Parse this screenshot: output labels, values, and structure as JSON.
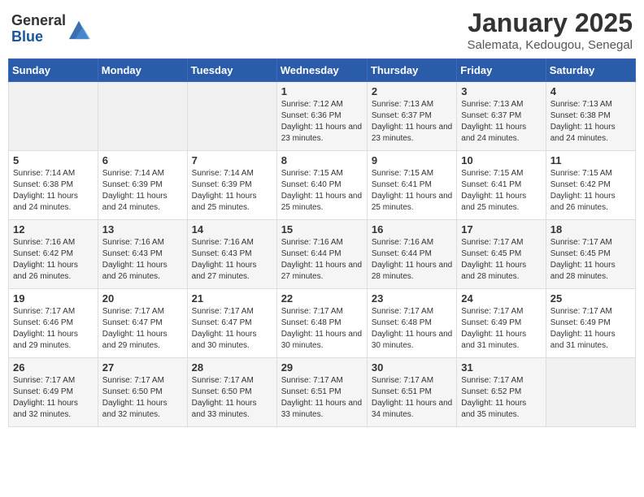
{
  "header": {
    "logo_general": "General",
    "logo_blue": "Blue",
    "month_title": "January 2025",
    "location": "Salemata, Kedougou, Senegal"
  },
  "weekdays": [
    "Sunday",
    "Monday",
    "Tuesday",
    "Wednesday",
    "Thursday",
    "Friday",
    "Saturday"
  ],
  "weeks": [
    [
      {
        "day": "",
        "sunrise": "",
        "sunset": "",
        "daylight": ""
      },
      {
        "day": "",
        "sunrise": "",
        "sunset": "",
        "daylight": ""
      },
      {
        "day": "",
        "sunrise": "",
        "sunset": "",
        "daylight": ""
      },
      {
        "day": "1",
        "sunrise": "Sunrise: 7:12 AM",
        "sunset": "Sunset: 6:36 PM",
        "daylight": "Daylight: 11 hours and 23 minutes."
      },
      {
        "day": "2",
        "sunrise": "Sunrise: 7:13 AM",
        "sunset": "Sunset: 6:37 PM",
        "daylight": "Daylight: 11 hours and 23 minutes."
      },
      {
        "day": "3",
        "sunrise": "Sunrise: 7:13 AM",
        "sunset": "Sunset: 6:37 PM",
        "daylight": "Daylight: 11 hours and 24 minutes."
      },
      {
        "day": "4",
        "sunrise": "Sunrise: 7:13 AM",
        "sunset": "Sunset: 6:38 PM",
        "daylight": "Daylight: 11 hours and 24 minutes."
      }
    ],
    [
      {
        "day": "5",
        "sunrise": "Sunrise: 7:14 AM",
        "sunset": "Sunset: 6:38 PM",
        "daylight": "Daylight: 11 hours and 24 minutes."
      },
      {
        "day": "6",
        "sunrise": "Sunrise: 7:14 AM",
        "sunset": "Sunset: 6:39 PM",
        "daylight": "Daylight: 11 hours and 24 minutes."
      },
      {
        "day": "7",
        "sunrise": "Sunrise: 7:14 AM",
        "sunset": "Sunset: 6:39 PM",
        "daylight": "Daylight: 11 hours and 25 minutes."
      },
      {
        "day": "8",
        "sunrise": "Sunrise: 7:15 AM",
        "sunset": "Sunset: 6:40 PM",
        "daylight": "Daylight: 11 hours and 25 minutes."
      },
      {
        "day": "9",
        "sunrise": "Sunrise: 7:15 AM",
        "sunset": "Sunset: 6:41 PM",
        "daylight": "Daylight: 11 hours and 25 minutes."
      },
      {
        "day": "10",
        "sunrise": "Sunrise: 7:15 AM",
        "sunset": "Sunset: 6:41 PM",
        "daylight": "Daylight: 11 hours and 25 minutes."
      },
      {
        "day": "11",
        "sunrise": "Sunrise: 7:15 AM",
        "sunset": "Sunset: 6:42 PM",
        "daylight": "Daylight: 11 hours and 26 minutes."
      }
    ],
    [
      {
        "day": "12",
        "sunrise": "Sunrise: 7:16 AM",
        "sunset": "Sunset: 6:42 PM",
        "daylight": "Daylight: 11 hours and 26 minutes."
      },
      {
        "day": "13",
        "sunrise": "Sunrise: 7:16 AM",
        "sunset": "Sunset: 6:43 PM",
        "daylight": "Daylight: 11 hours and 26 minutes."
      },
      {
        "day": "14",
        "sunrise": "Sunrise: 7:16 AM",
        "sunset": "Sunset: 6:43 PM",
        "daylight": "Daylight: 11 hours and 27 minutes."
      },
      {
        "day": "15",
        "sunrise": "Sunrise: 7:16 AM",
        "sunset": "Sunset: 6:44 PM",
        "daylight": "Daylight: 11 hours and 27 minutes."
      },
      {
        "day": "16",
        "sunrise": "Sunrise: 7:16 AM",
        "sunset": "Sunset: 6:44 PM",
        "daylight": "Daylight: 11 hours and 28 minutes."
      },
      {
        "day": "17",
        "sunrise": "Sunrise: 7:17 AM",
        "sunset": "Sunset: 6:45 PM",
        "daylight": "Daylight: 11 hours and 28 minutes."
      },
      {
        "day": "18",
        "sunrise": "Sunrise: 7:17 AM",
        "sunset": "Sunset: 6:45 PM",
        "daylight": "Daylight: 11 hours and 28 minutes."
      }
    ],
    [
      {
        "day": "19",
        "sunrise": "Sunrise: 7:17 AM",
        "sunset": "Sunset: 6:46 PM",
        "daylight": "Daylight: 11 hours and 29 minutes."
      },
      {
        "day": "20",
        "sunrise": "Sunrise: 7:17 AM",
        "sunset": "Sunset: 6:47 PM",
        "daylight": "Daylight: 11 hours and 29 minutes."
      },
      {
        "day": "21",
        "sunrise": "Sunrise: 7:17 AM",
        "sunset": "Sunset: 6:47 PM",
        "daylight": "Daylight: 11 hours and 30 minutes."
      },
      {
        "day": "22",
        "sunrise": "Sunrise: 7:17 AM",
        "sunset": "Sunset: 6:48 PM",
        "daylight": "Daylight: 11 hours and 30 minutes."
      },
      {
        "day": "23",
        "sunrise": "Sunrise: 7:17 AM",
        "sunset": "Sunset: 6:48 PM",
        "daylight": "Daylight: 11 hours and 30 minutes."
      },
      {
        "day": "24",
        "sunrise": "Sunrise: 7:17 AM",
        "sunset": "Sunset: 6:49 PM",
        "daylight": "Daylight: 11 hours and 31 minutes."
      },
      {
        "day": "25",
        "sunrise": "Sunrise: 7:17 AM",
        "sunset": "Sunset: 6:49 PM",
        "daylight": "Daylight: 11 hours and 31 minutes."
      }
    ],
    [
      {
        "day": "26",
        "sunrise": "Sunrise: 7:17 AM",
        "sunset": "Sunset: 6:49 PM",
        "daylight": "Daylight: 11 hours and 32 minutes."
      },
      {
        "day": "27",
        "sunrise": "Sunrise: 7:17 AM",
        "sunset": "Sunset: 6:50 PM",
        "daylight": "Daylight: 11 hours and 32 minutes."
      },
      {
        "day": "28",
        "sunrise": "Sunrise: 7:17 AM",
        "sunset": "Sunset: 6:50 PM",
        "daylight": "Daylight: 11 hours and 33 minutes."
      },
      {
        "day": "29",
        "sunrise": "Sunrise: 7:17 AM",
        "sunset": "Sunset: 6:51 PM",
        "daylight": "Daylight: 11 hours and 33 minutes."
      },
      {
        "day": "30",
        "sunrise": "Sunrise: 7:17 AM",
        "sunset": "Sunset: 6:51 PM",
        "daylight": "Daylight: 11 hours and 34 minutes."
      },
      {
        "day": "31",
        "sunrise": "Sunrise: 7:17 AM",
        "sunset": "Sunset: 6:52 PM",
        "daylight": "Daylight: 11 hours and 35 minutes."
      },
      {
        "day": "",
        "sunrise": "",
        "sunset": "",
        "daylight": ""
      }
    ]
  ]
}
